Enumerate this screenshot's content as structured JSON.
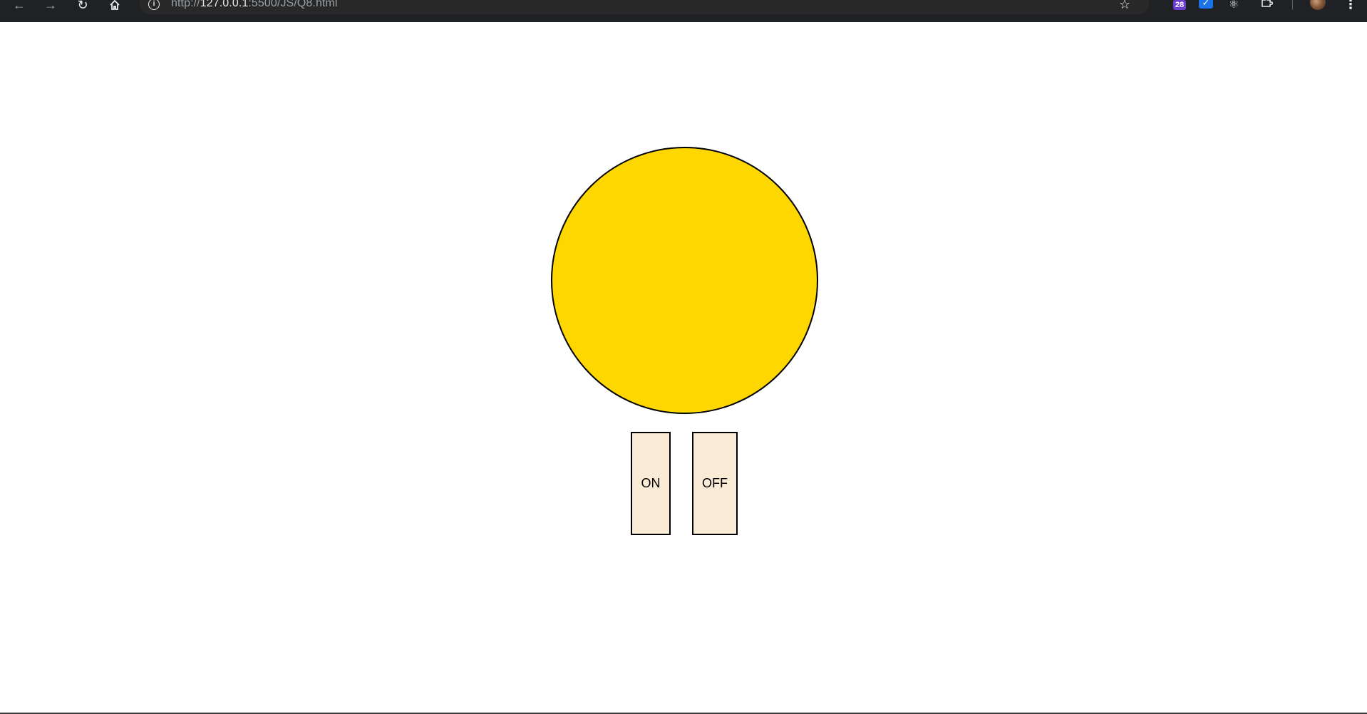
{
  "browser": {
    "url_scheme": "http://",
    "url_host": "127.0.0.1",
    "url_rest": ":5500/JS/Q8.html",
    "extension_badge": "28",
    "icons": {
      "back": "arrow-left-icon",
      "forward": "arrow-right-icon",
      "reload": "reload-icon",
      "home": "home-icon",
      "site_info": "info-icon",
      "bookmark": "star-icon",
      "check_extension": "check-icon",
      "react_extension": "atom-icon",
      "extensions": "puzzle-icon",
      "menu": "more-vert-icon"
    }
  },
  "bulb": {
    "state": "on",
    "color_on": "#FFD700",
    "color_off": "#ffffff"
  },
  "switches": {
    "on_label": "ON",
    "off_label": "OFF",
    "background": "#FAEBD7"
  }
}
